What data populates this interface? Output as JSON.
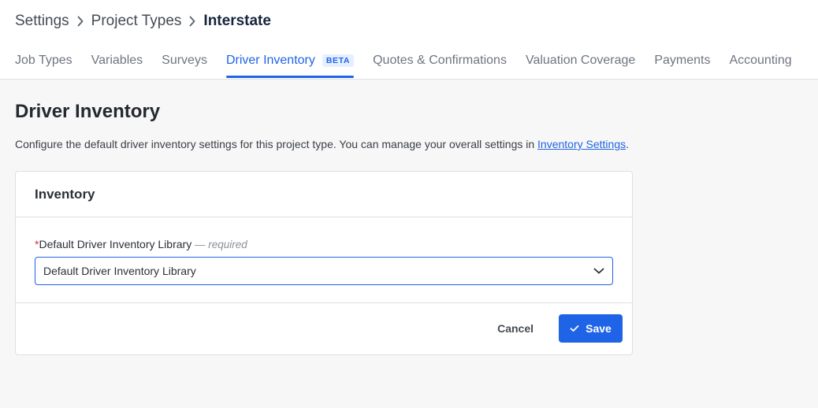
{
  "breadcrumb": {
    "items": [
      "Settings",
      "Project Types",
      "Interstate"
    ]
  },
  "tabs": [
    {
      "label": "Job Types",
      "active": false
    },
    {
      "label": "Variables",
      "active": false
    },
    {
      "label": "Surveys",
      "active": false
    },
    {
      "label": "Driver Inventory",
      "active": true,
      "badge": "BETA"
    },
    {
      "label": "Quotes & Confirmations",
      "active": false
    },
    {
      "label": "Valuation Coverage",
      "active": false
    },
    {
      "label": "Payments",
      "active": false
    },
    {
      "label": "Accounting",
      "active": false
    }
  ],
  "page": {
    "title": "Driver Inventory",
    "description_prefix": "Configure the default driver inventory settings for this project type. You can manage your overall settings in ",
    "description_link": "Inventory Settings",
    "description_suffix": "."
  },
  "card": {
    "title": "Inventory",
    "field": {
      "required_marker": "*",
      "label": "Default Driver Inventory Library",
      "required_note": " — required",
      "value": "Default Driver Inventory Library"
    },
    "cancel_label": "Cancel",
    "save_label": "Save"
  },
  "colors": {
    "accent": "#1f64e6",
    "background": "#f7f7f7",
    "required": "#d33a3a"
  },
  "icons": {
    "breadcrumb_separator": "chevron-right-icon",
    "select": "chevron-down-icon",
    "save": "check-icon"
  }
}
